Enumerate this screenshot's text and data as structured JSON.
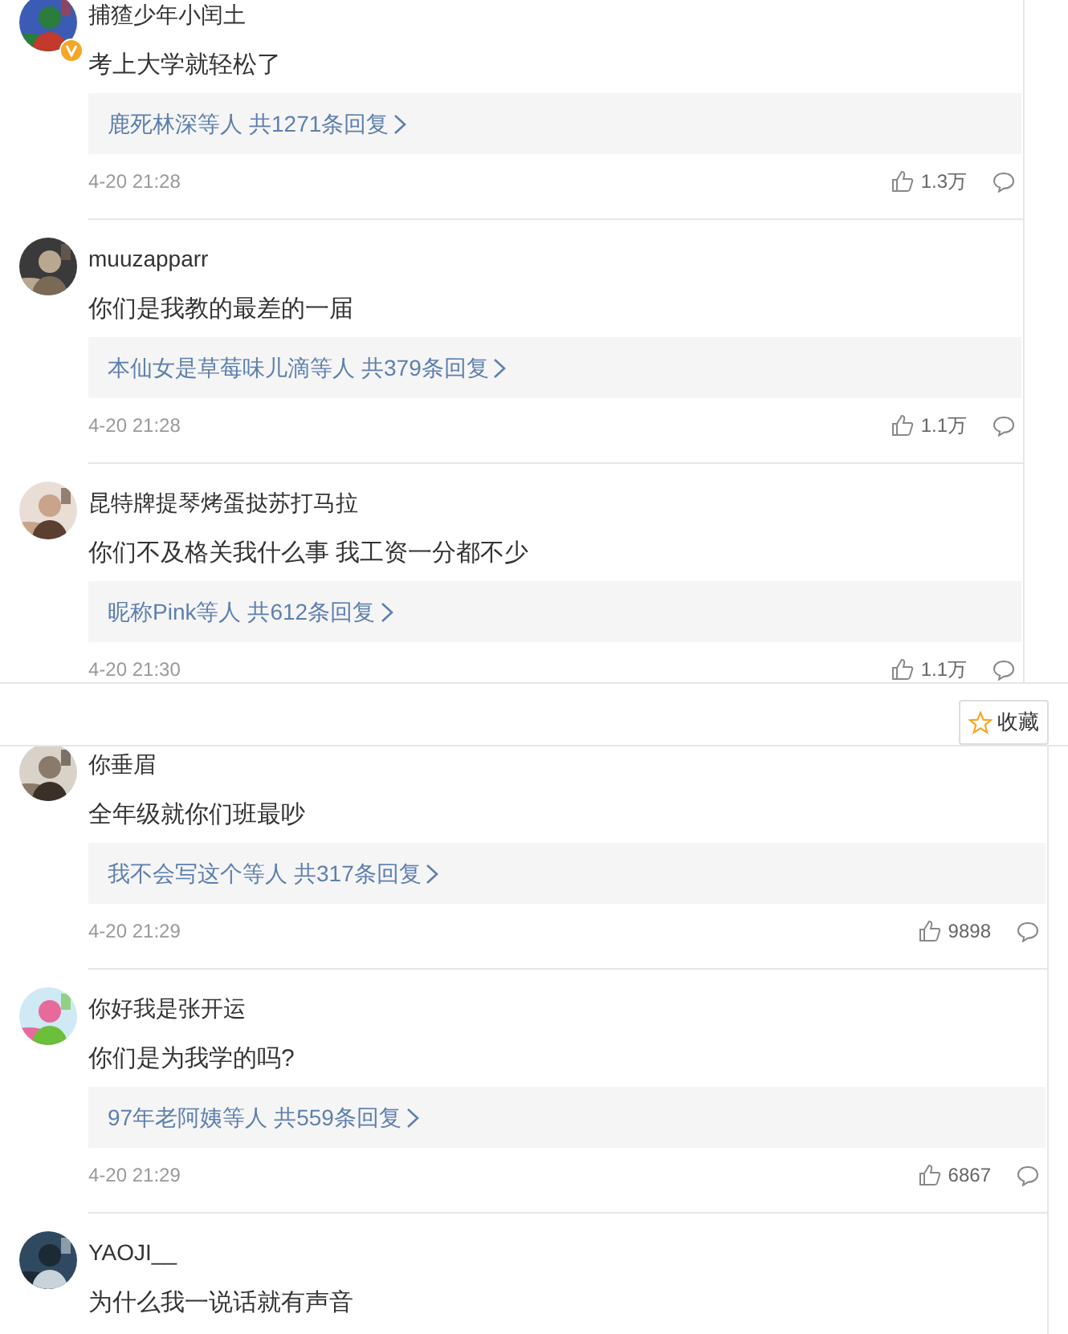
{
  "top_panel": {
    "comments": [
      {
        "name": "捕猹少年小闰土",
        "verified": true,
        "text": "考上大学就轻松了",
        "replies": {
          "users": "鹿死林深等人",
          "count": "共1271条回复"
        },
        "time": "4-20 21:28",
        "likes": "1.3万"
      },
      {
        "name": "muuzapparr",
        "verified": false,
        "text": "你们是我教的最差的一届",
        "replies": {
          "users": "本仙女是草莓味儿滴等人",
          "count": "共379条回复"
        },
        "time": "4-20 21:28",
        "likes": "1.1万"
      },
      {
        "name": "昆特牌提琴烤蛋挞苏打马拉",
        "verified": false,
        "text": "你们不及格关我什么事 我工资一分都不少",
        "replies": {
          "users": "昵称Pink等人",
          "count": "共612条回复"
        },
        "time": "4-20 21:30",
        "likes": "1.1万"
      }
    ]
  },
  "favorite_button": {
    "label": "收藏"
  },
  "bottom_panel": {
    "comments": [
      {
        "name": "你垂眉",
        "verified": false,
        "text": "全年级就你们班最吵",
        "replies": {
          "users": "我不会写这个等人",
          "count": "共317条回复"
        },
        "time": "4-20 21:29",
        "likes": "9898"
      },
      {
        "name": "你好我是张开运",
        "verified": false,
        "text": "你们是为我学的吗?",
        "replies": {
          "users": "97年老阿姨等人",
          "count": "共559条回复"
        },
        "time": "4-20 21:29",
        "likes": "6867"
      },
      {
        "name": "YAOJI__",
        "verified": false,
        "text": "为什么我一说话就有声音"
      }
    ]
  }
}
